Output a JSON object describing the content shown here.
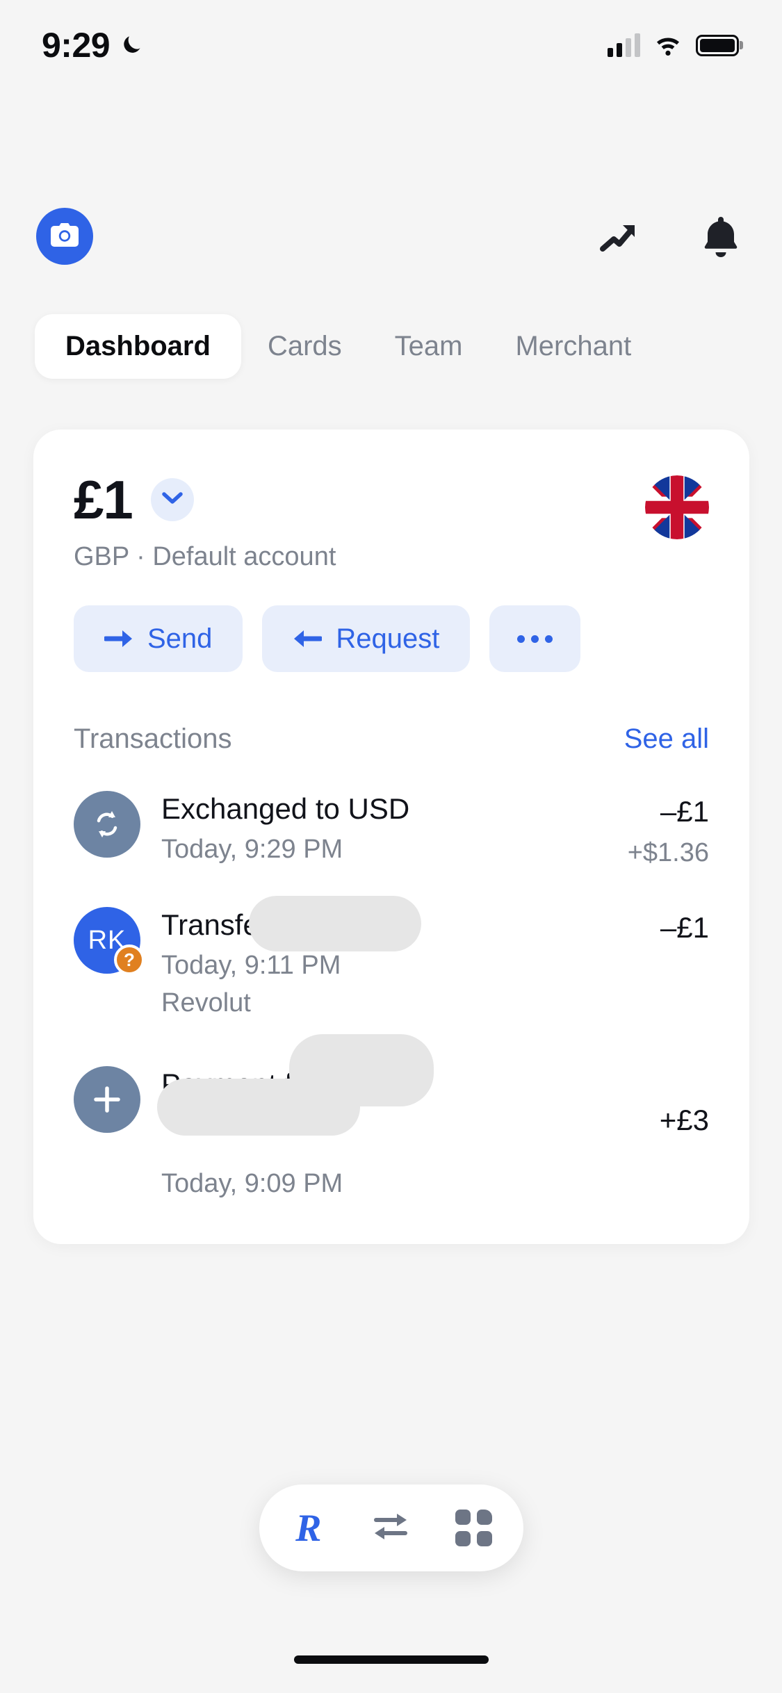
{
  "status_bar": {
    "time": "9:29",
    "dnd_icon": "moon-icon",
    "signal_icon": "cellular-signal-icon",
    "wifi_icon": "wifi-icon",
    "battery_icon": "battery-icon"
  },
  "header": {
    "avatar_icon": "camera-icon",
    "trending_icon": "trending-up-icon",
    "notifications_icon": "bell-icon"
  },
  "tabs": [
    {
      "label": "Dashboard",
      "active": true
    },
    {
      "label": "Cards",
      "active": false
    },
    {
      "label": "Team",
      "active": false
    },
    {
      "label": "Merchant",
      "active": false
    }
  ],
  "account": {
    "balance": "£1",
    "chevron_icon": "chevron-down-icon",
    "subtitle": "GBP · Default account",
    "flag_icon": "uk-flag-icon"
  },
  "actions": [
    {
      "label": "Send",
      "icon": "arrow-right-icon"
    },
    {
      "label": "Request",
      "icon": "arrow-left-icon"
    },
    {
      "label": "",
      "icon": "ellipsis-icon"
    }
  ],
  "transactions_section": {
    "title": "Transactions",
    "see_all": "See all"
  },
  "transactions": [
    {
      "icon": "exchange-icon",
      "icon_style": "slate",
      "initials": "",
      "badge": "",
      "title": "Exchanged to USD",
      "subtitle": "Today, 9:29 PM",
      "subtitle2": "",
      "amount": "–£1",
      "amount2": "+$1.36",
      "redacted": false
    },
    {
      "icon": "contact-initials-icon",
      "icon_style": "blue",
      "initials": "RK",
      "badge": "?",
      "title": "Transfer to",
      "subtitle": "Today, 9:11 PM",
      "subtitle2": "Revolut",
      "amount": "–£1",
      "amount2": "",
      "redacted": true
    },
    {
      "icon": "plus-icon",
      "icon_style": "slate",
      "initials": "",
      "badge": "",
      "title": "Payment from",
      "subtitle": "Today, 9:09 PM",
      "subtitle2": "",
      "amount": "+£3",
      "amount2": "",
      "redacted": true
    }
  ],
  "bottom_nav": [
    {
      "icon": "revolut-r-logo-icon",
      "label": "R",
      "active": true
    },
    {
      "icon": "transfer-arrows-icon",
      "label": "",
      "active": false
    },
    {
      "icon": "grid-apps-icon",
      "label": "",
      "active": false
    }
  ],
  "colors": {
    "accent_blue": "#2f63e6",
    "accent_blue_soft": "#e8eefb",
    "slate": "#6d84a3",
    "badge_orange": "#e08020",
    "text_primary": "#11131a",
    "text_muted": "#7d838e",
    "background": "#f5f5f5",
    "card": "#ffffff"
  }
}
